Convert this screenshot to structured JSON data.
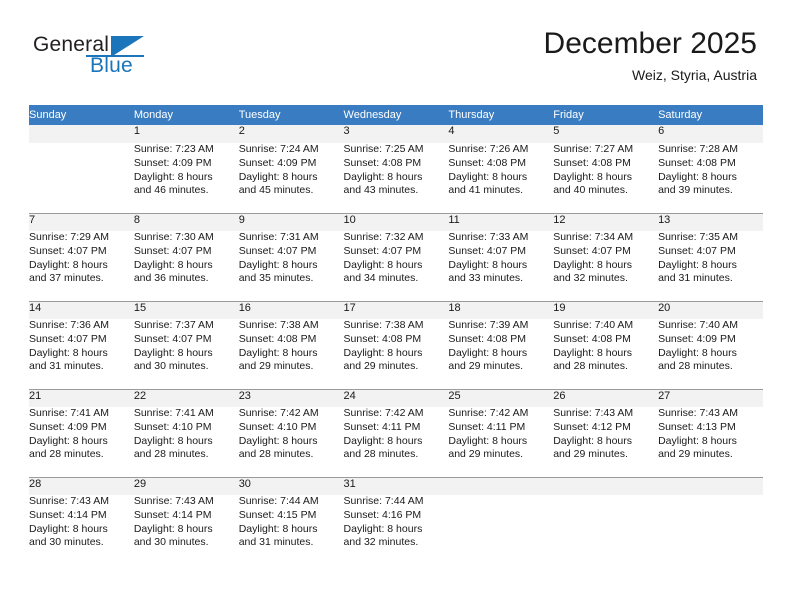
{
  "brand": {
    "name_part1": "General",
    "name_part2": "Blue",
    "accent_color": "#1b75bb"
  },
  "header": {
    "title": "December 2025",
    "location": "Weiz, Styria, Austria",
    "header_bg_color": "#3a7cc1"
  },
  "calendar": {
    "weekday_headers": [
      "Sunday",
      "Monday",
      "Tuesday",
      "Wednesday",
      "Thursday",
      "Friday",
      "Saturday"
    ],
    "weeks": [
      [
        {
          "day": "",
          "sunrise": "",
          "sunset": "",
          "daylight_line1": "",
          "daylight_line2": ""
        },
        {
          "day": "1",
          "sunrise": "Sunrise: 7:23 AM",
          "sunset": "Sunset: 4:09 PM",
          "daylight_line1": "Daylight: 8 hours",
          "daylight_line2": "and 46 minutes."
        },
        {
          "day": "2",
          "sunrise": "Sunrise: 7:24 AM",
          "sunset": "Sunset: 4:09 PM",
          "daylight_line1": "Daylight: 8 hours",
          "daylight_line2": "and 45 minutes."
        },
        {
          "day": "3",
          "sunrise": "Sunrise: 7:25 AM",
          "sunset": "Sunset: 4:08 PM",
          "daylight_line1": "Daylight: 8 hours",
          "daylight_line2": "and 43 minutes."
        },
        {
          "day": "4",
          "sunrise": "Sunrise: 7:26 AM",
          "sunset": "Sunset: 4:08 PM",
          "daylight_line1": "Daylight: 8 hours",
          "daylight_line2": "and 41 minutes."
        },
        {
          "day": "5",
          "sunrise": "Sunrise: 7:27 AM",
          "sunset": "Sunset: 4:08 PM",
          "daylight_line1": "Daylight: 8 hours",
          "daylight_line2": "and 40 minutes."
        },
        {
          "day": "6",
          "sunrise": "Sunrise: 7:28 AM",
          "sunset": "Sunset: 4:08 PM",
          "daylight_line1": "Daylight: 8 hours",
          "daylight_line2": "and 39 minutes."
        }
      ],
      [
        {
          "day": "7",
          "sunrise": "Sunrise: 7:29 AM",
          "sunset": "Sunset: 4:07 PM",
          "daylight_line1": "Daylight: 8 hours",
          "daylight_line2": "and 37 minutes."
        },
        {
          "day": "8",
          "sunrise": "Sunrise: 7:30 AM",
          "sunset": "Sunset: 4:07 PM",
          "daylight_line1": "Daylight: 8 hours",
          "daylight_line2": "and 36 minutes."
        },
        {
          "day": "9",
          "sunrise": "Sunrise: 7:31 AM",
          "sunset": "Sunset: 4:07 PM",
          "daylight_line1": "Daylight: 8 hours",
          "daylight_line2": "and 35 minutes."
        },
        {
          "day": "10",
          "sunrise": "Sunrise: 7:32 AM",
          "sunset": "Sunset: 4:07 PM",
          "daylight_line1": "Daylight: 8 hours",
          "daylight_line2": "and 34 minutes."
        },
        {
          "day": "11",
          "sunrise": "Sunrise: 7:33 AM",
          "sunset": "Sunset: 4:07 PM",
          "daylight_line1": "Daylight: 8 hours",
          "daylight_line2": "and 33 minutes."
        },
        {
          "day": "12",
          "sunrise": "Sunrise: 7:34 AM",
          "sunset": "Sunset: 4:07 PM",
          "daylight_line1": "Daylight: 8 hours",
          "daylight_line2": "and 32 minutes."
        },
        {
          "day": "13",
          "sunrise": "Sunrise: 7:35 AM",
          "sunset": "Sunset: 4:07 PM",
          "daylight_line1": "Daylight: 8 hours",
          "daylight_line2": "and 31 minutes."
        }
      ],
      [
        {
          "day": "14",
          "sunrise": "Sunrise: 7:36 AM",
          "sunset": "Sunset: 4:07 PM",
          "daylight_line1": "Daylight: 8 hours",
          "daylight_line2": "and 31 minutes."
        },
        {
          "day": "15",
          "sunrise": "Sunrise: 7:37 AM",
          "sunset": "Sunset: 4:07 PM",
          "daylight_line1": "Daylight: 8 hours",
          "daylight_line2": "and 30 minutes."
        },
        {
          "day": "16",
          "sunrise": "Sunrise: 7:38 AM",
          "sunset": "Sunset: 4:08 PM",
          "daylight_line1": "Daylight: 8 hours",
          "daylight_line2": "and 29 minutes."
        },
        {
          "day": "17",
          "sunrise": "Sunrise: 7:38 AM",
          "sunset": "Sunset: 4:08 PM",
          "daylight_line1": "Daylight: 8 hours",
          "daylight_line2": "and 29 minutes."
        },
        {
          "day": "18",
          "sunrise": "Sunrise: 7:39 AM",
          "sunset": "Sunset: 4:08 PM",
          "daylight_line1": "Daylight: 8 hours",
          "daylight_line2": "and 29 minutes."
        },
        {
          "day": "19",
          "sunrise": "Sunrise: 7:40 AM",
          "sunset": "Sunset: 4:08 PM",
          "daylight_line1": "Daylight: 8 hours",
          "daylight_line2": "and 28 minutes."
        },
        {
          "day": "20",
          "sunrise": "Sunrise: 7:40 AM",
          "sunset": "Sunset: 4:09 PM",
          "daylight_line1": "Daylight: 8 hours",
          "daylight_line2": "and 28 minutes."
        }
      ],
      [
        {
          "day": "21",
          "sunrise": "Sunrise: 7:41 AM",
          "sunset": "Sunset: 4:09 PM",
          "daylight_line1": "Daylight: 8 hours",
          "daylight_line2": "and 28 minutes."
        },
        {
          "day": "22",
          "sunrise": "Sunrise: 7:41 AM",
          "sunset": "Sunset: 4:10 PM",
          "daylight_line1": "Daylight: 8 hours",
          "daylight_line2": "and 28 minutes."
        },
        {
          "day": "23",
          "sunrise": "Sunrise: 7:42 AM",
          "sunset": "Sunset: 4:10 PM",
          "daylight_line1": "Daylight: 8 hours",
          "daylight_line2": "and 28 minutes."
        },
        {
          "day": "24",
          "sunrise": "Sunrise: 7:42 AM",
          "sunset": "Sunset: 4:11 PM",
          "daylight_line1": "Daylight: 8 hours",
          "daylight_line2": "and 28 minutes."
        },
        {
          "day": "25",
          "sunrise": "Sunrise: 7:42 AM",
          "sunset": "Sunset: 4:11 PM",
          "daylight_line1": "Daylight: 8 hours",
          "daylight_line2": "and 29 minutes."
        },
        {
          "day": "26",
          "sunrise": "Sunrise: 7:43 AM",
          "sunset": "Sunset: 4:12 PM",
          "daylight_line1": "Daylight: 8 hours",
          "daylight_line2": "and 29 minutes."
        },
        {
          "day": "27",
          "sunrise": "Sunrise: 7:43 AM",
          "sunset": "Sunset: 4:13 PM",
          "daylight_line1": "Daylight: 8 hours",
          "daylight_line2": "and 29 minutes."
        }
      ],
      [
        {
          "day": "28",
          "sunrise": "Sunrise: 7:43 AM",
          "sunset": "Sunset: 4:14 PM",
          "daylight_line1": "Daylight: 8 hours",
          "daylight_line2": "and 30 minutes."
        },
        {
          "day": "29",
          "sunrise": "Sunrise: 7:43 AM",
          "sunset": "Sunset: 4:14 PM",
          "daylight_line1": "Daylight: 8 hours",
          "daylight_line2": "and 30 minutes."
        },
        {
          "day": "30",
          "sunrise": "Sunrise: 7:44 AM",
          "sunset": "Sunset: 4:15 PM",
          "daylight_line1": "Daylight: 8 hours",
          "daylight_line2": "and 31 minutes."
        },
        {
          "day": "31",
          "sunrise": "Sunrise: 7:44 AM",
          "sunset": "Sunset: 4:16 PM",
          "daylight_line1": "Daylight: 8 hours",
          "daylight_line2": "and 32 minutes."
        },
        {
          "day": "",
          "sunrise": "",
          "sunset": "",
          "daylight_line1": "",
          "daylight_line2": ""
        },
        {
          "day": "",
          "sunrise": "",
          "sunset": "",
          "daylight_line1": "",
          "daylight_line2": ""
        },
        {
          "day": "",
          "sunrise": "",
          "sunset": "",
          "daylight_line1": "",
          "daylight_line2": ""
        }
      ]
    ]
  }
}
